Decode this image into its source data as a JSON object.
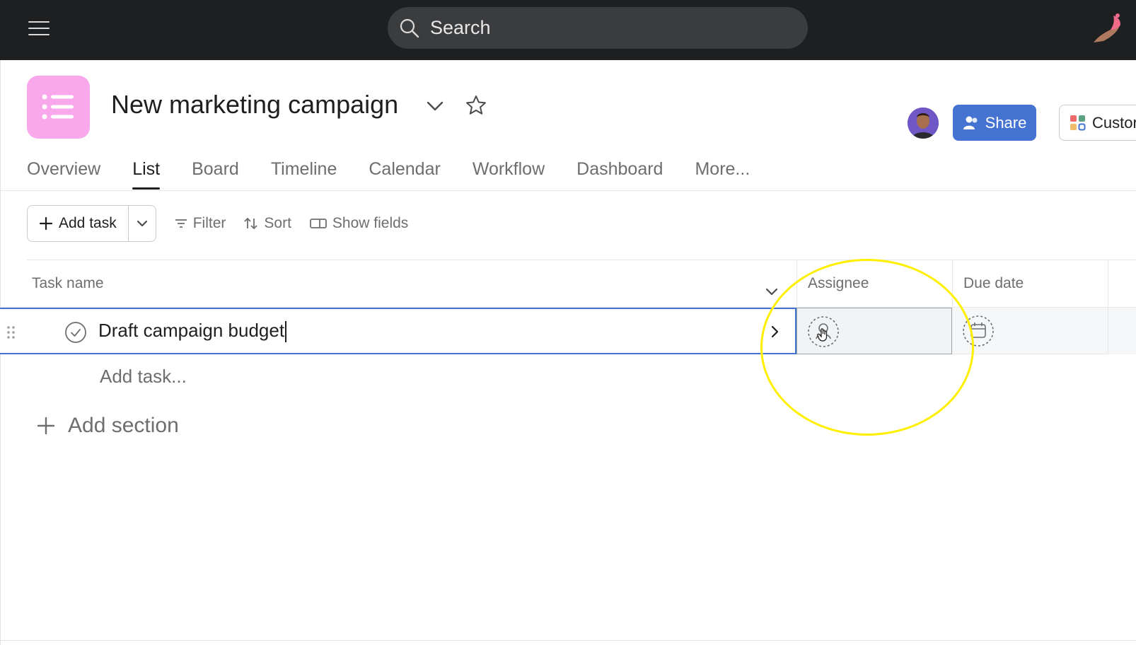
{
  "topbar": {
    "search_placeholder": "Search",
    "menu_icon": "hamburger-icon",
    "search_icon": "search-icon",
    "logo_icon": "bird-logo-icon"
  },
  "project": {
    "title": "New marketing campaign",
    "icon": "list-icon",
    "icon_color": "#f9a8eb"
  },
  "header_actions": {
    "share_label": "Share",
    "customize_label": "Custor",
    "share_color": "#4573d2"
  },
  "tabs": [
    {
      "label": "Overview",
      "active": false
    },
    {
      "label": "List",
      "active": true
    },
    {
      "label": "Board",
      "active": false
    },
    {
      "label": "Timeline",
      "active": false
    },
    {
      "label": "Calendar",
      "active": false
    },
    {
      "label": "Workflow",
      "active": false
    },
    {
      "label": "Dashboard",
      "active": false
    },
    {
      "label": "More...",
      "active": false
    }
  ],
  "toolbar": {
    "add_task_label": "Add task",
    "filter_label": "Filter",
    "sort_label": "Sort",
    "show_fields_label": "Show fields"
  },
  "table": {
    "columns": {
      "task_name": "Task name",
      "assignee": "Assignee",
      "due_date": "Due date"
    },
    "rows": [
      {
        "name": "Draft campaign budget"
      }
    ],
    "add_task_placeholder": "Add task...",
    "add_section_label": "Add section"
  },
  "annotation": {
    "highlight_color": "#ffef00"
  }
}
